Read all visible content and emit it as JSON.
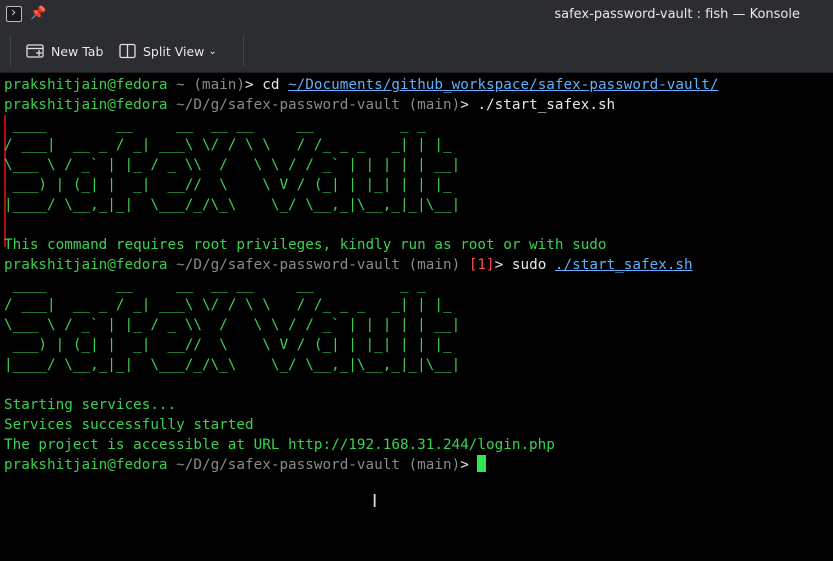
{
  "window": {
    "title": "safex-password-vault : fish — Konsole"
  },
  "toolbar": {
    "new_tab": "New Tab",
    "split_view": "Split View"
  },
  "terminal": {
    "prompt_user": "prakshitjain@fedora",
    "l1": {
      "dir": " ~ ",
      "branch": "(main)",
      "gt": "> ",
      "cmd": "cd ",
      "path": "~/Documents/github_workspace/safex-password-vault/"
    },
    "l2": {
      "dir": " ~/D/g/safex-password-vault ",
      "branch": "(main)",
      "gt": "> ",
      "cmd": "./start_safex.sh"
    },
    "banner": [
      " ____        __     __  __ __     __          _ _",
      "/ ___|  __ _ / _| ___\\ \\/ / \\ \\   / /_ _ _   _| | |_",
      "\\___ \\ / _` | |_ / _ \\\\  /   \\ \\ / / _` | | | | | __|",
      " ___) | (_| |  _|  __//  \\    \\ V / (_| | |_| | | |_",
      "|____/ \\__,_|_|  \\___/_/\\_\\    \\_/ \\__,_|\\__,_|_|\\__|"
    ],
    "root_msg": "This command requires root privileges, kindly run as root or with sudo",
    "l3": {
      "dir": " ~/D/g/safex-password-vault ",
      "branch": "(main) ",
      "status": "[1]",
      "gt": "> ",
      "cmd": "sudo ",
      "path": "./start_safex.sh"
    },
    "starting": "Starting services...",
    "started": "Services successfully started",
    "url_msg": "The project is accessible at URL http://192.168.31.244/login.php",
    "l4": {
      "dir": " ~/D/g/safex-password-vault ",
      "branch": "(main)",
      "gt": "> "
    }
  }
}
